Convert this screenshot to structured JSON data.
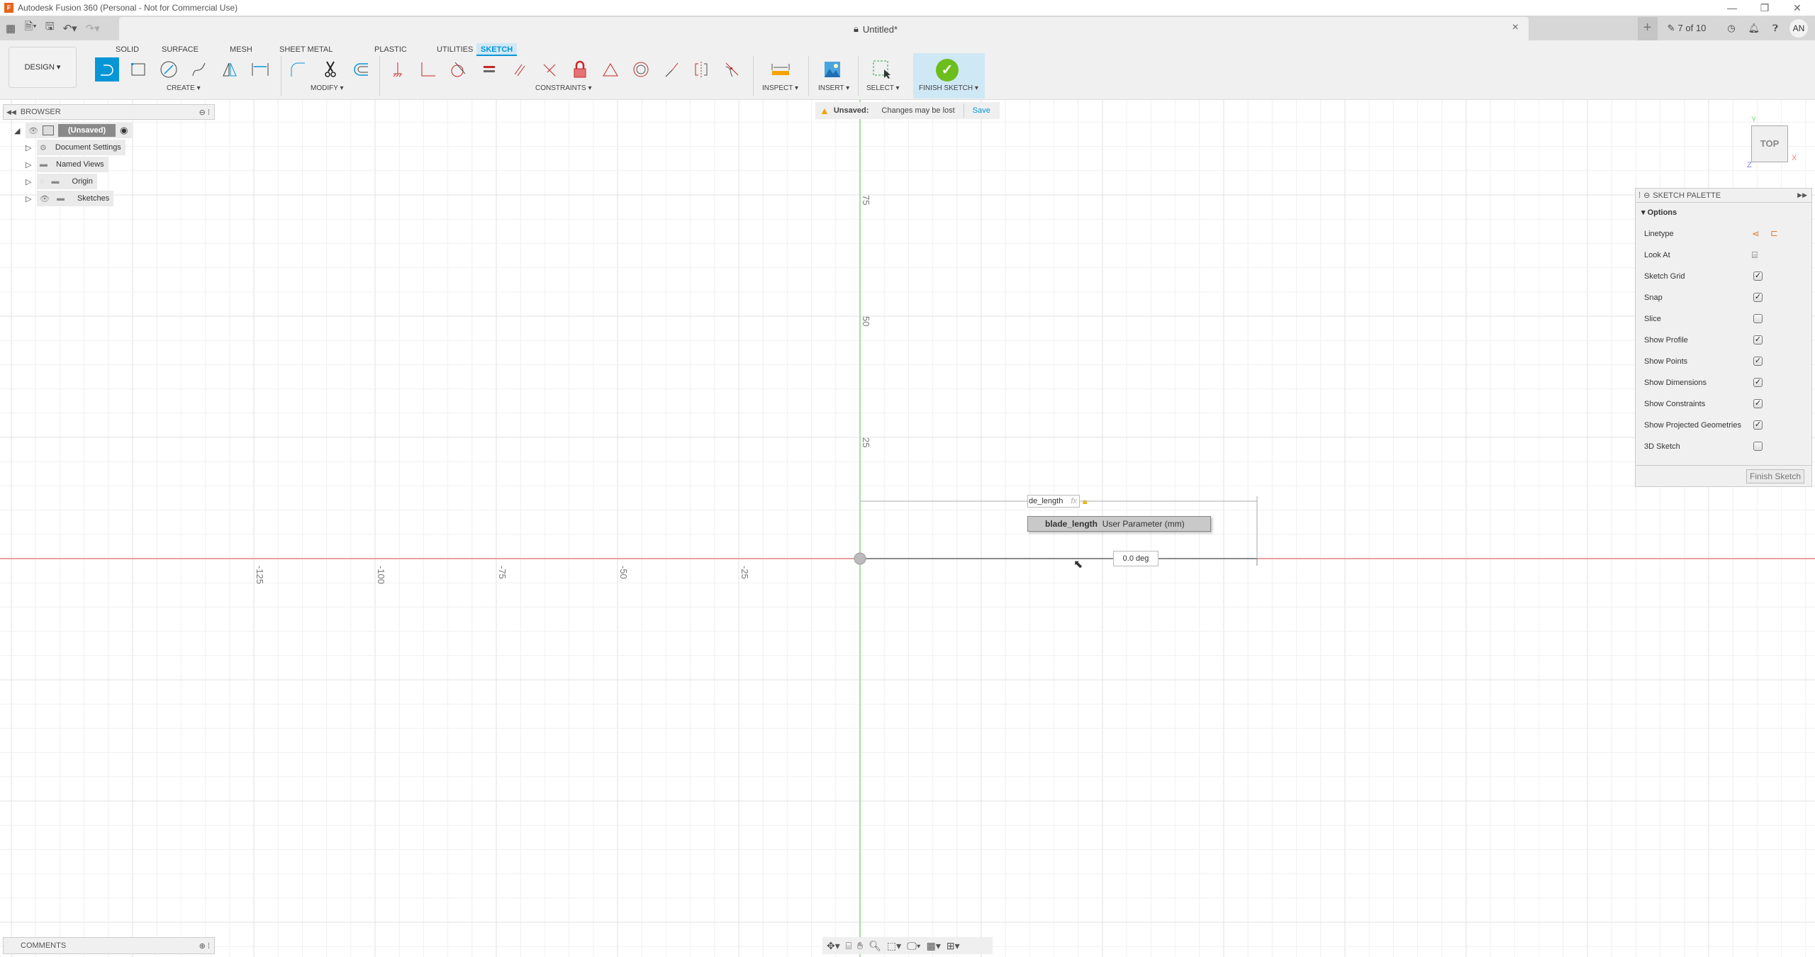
{
  "titlebar": {
    "app_title": "Autodesk Fusion 360 (Personal - Not for Commercial Use)",
    "app_icon": "F"
  },
  "document": {
    "title": "Untitled*"
  },
  "header_right": {
    "job_status": "7 of 10",
    "avatar": "AN"
  },
  "workspace": {
    "label": "DESIGN ▾"
  },
  "ribbon": {
    "tabs": [
      {
        "label": "SOLID"
      },
      {
        "label": "SURFACE"
      },
      {
        "label": "MESH"
      },
      {
        "label": "SHEET METAL"
      },
      {
        "label": "PLASTIC"
      },
      {
        "label": "UTILITIES"
      },
      {
        "label": "SKETCH",
        "active": true
      }
    ],
    "groups": {
      "create": "CREATE ▾",
      "modify": "MODIFY ▾",
      "constraints": "CONSTRAINTS ▾",
      "inspect": "INSPECT ▾",
      "insert": "INSERT ▾",
      "select": "SELECT ▾",
      "finish": "FINISH SKETCH ▾"
    }
  },
  "browser": {
    "title": "BROWSER",
    "root": "(Unsaved)",
    "items": [
      {
        "label": "Document Settings",
        "icon": "gear-icon"
      },
      {
        "label": "Named Views",
        "icon": "folder-icon"
      },
      {
        "label": "Origin",
        "icon": "folder-icon",
        "hidden": true
      },
      {
        "label": "Sketches",
        "icon": "folder-icon"
      }
    ]
  },
  "unsaved_banner": {
    "label": "Unsaved:",
    "message": "Changes may be lost",
    "action": "Save"
  },
  "viewcube": {
    "face": "TOP",
    "axis_x": "X",
    "axis_y": "Y",
    "axis_z": "Z"
  },
  "sketch_palette": {
    "title": "SKETCH PALETTE",
    "section": "Options",
    "linetype_label": "Linetype",
    "look_at_label": "Look At",
    "options": [
      {
        "label": "Sketch Grid",
        "checked": true
      },
      {
        "label": "Snap",
        "checked": true
      },
      {
        "label": "Slice",
        "checked": false
      },
      {
        "label": "Show Profile",
        "checked": true
      },
      {
        "label": "Show Points",
        "checked": true
      },
      {
        "label": "Show Dimensions",
        "checked": true
      },
      {
        "label": "Show Constraints",
        "checked": true
      },
      {
        "label": "Show Projected Geometries",
        "checked": true
      },
      {
        "label": "3D Sketch",
        "checked": false
      }
    ],
    "finish_button": "Finish Sketch"
  },
  "canvas": {
    "y_ticks": [
      "75",
      "50",
      "25"
    ],
    "x_ticks": [
      "-125",
      "-100",
      "-75",
      "-50",
      "-25"
    ],
    "dimension_input": "de_length",
    "fx_label": "fx",
    "autocomplete": {
      "name": "blade_length",
      "desc": "User Parameter (mm)"
    },
    "angle_input": "0.0 deg"
  },
  "comments": {
    "title": "COMMENTS"
  }
}
